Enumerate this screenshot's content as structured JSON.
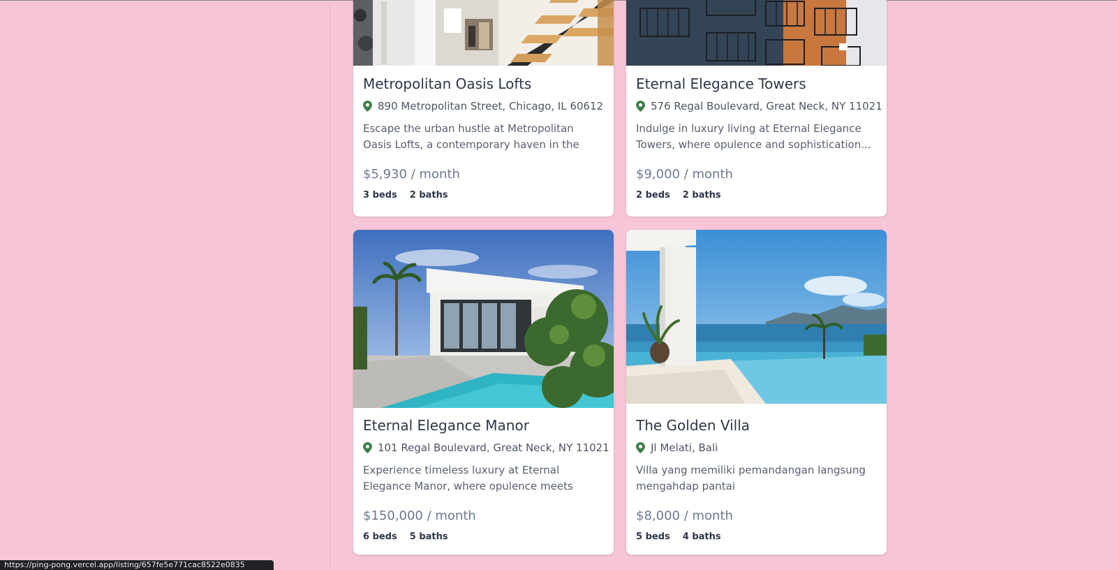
{
  "listings": [
    {
      "title": "Metropolitan Oasis Lofts",
      "address": "890 Metropolitan Street, Chicago, IL 60612",
      "description": "Escape the urban hustle at Metropolitan Oasis Lofts, a contemporary haven in the heart of...",
      "price": "$5,930 / month",
      "beds": "3 beds",
      "baths": "2 baths",
      "image_alt": "Interior with wooden staircase"
    },
    {
      "title": "Eternal Elegance Towers",
      "address": "576 Regal Boulevard, Great Neck, NY 11021",
      "description": "Indulge in luxury living at Eternal Elegance Towers, where opulence and sophistication...",
      "price": "$9,000 / month",
      "beds": "2 beds",
      "baths": "2 baths",
      "image_alt": "Apartment building with balconies"
    },
    {
      "title": "Eternal Elegance Manor",
      "address": "101 Regal Boulevard, Great Neck, NY 11021",
      "description": "Experience timeless luxury at Eternal Elegance Manor, where opulence meets sophistication....",
      "price": "$150,000 / month",
      "beds": "6 beds",
      "baths": "5 baths",
      "image_alt": "White modern house with pool"
    },
    {
      "title": "The Golden Villa",
      "address": "Jl Melati, Bali",
      "description": "Villa yang memiliki pemandangan langsung mengahdap pantai",
      "price": "$8,000 / month",
      "beds": "5 beds",
      "baths": "4 baths",
      "image_alt": "Infinity pool overlooking the sea"
    }
  ],
  "status_bar": {
    "url": "https://ping-pong.vercel.app/listing/657fe5e771cac8522e0835"
  },
  "colors": {
    "page_background": "#f6c5d7",
    "card_background": "#ffffff",
    "pin_icon": "#3f7f4a",
    "title_text": "#2d3748",
    "price_text": "#6b7a90"
  }
}
